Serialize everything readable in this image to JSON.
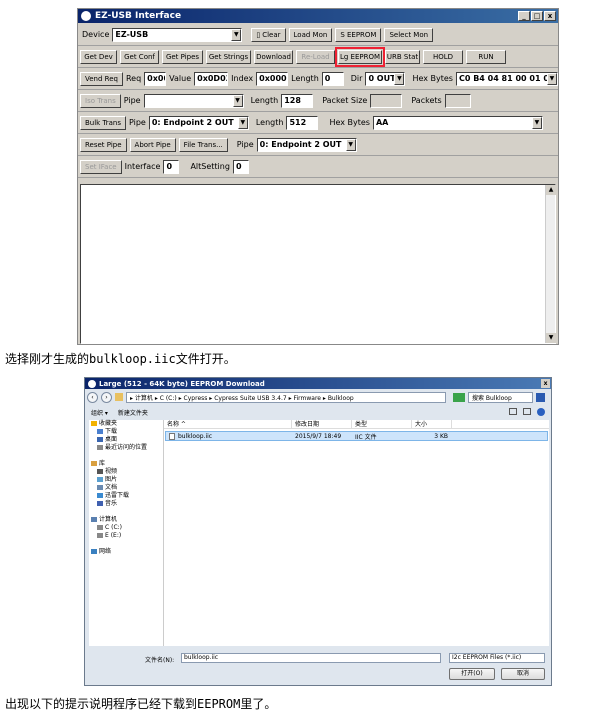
{
  "ezusb": {
    "title": "EZ-USB Interface",
    "win_buttons": [
      "_",
      "□",
      "x"
    ],
    "device_label": "Device",
    "device_value": "EZ-USB",
    "clear_label": "Clear",
    "top_buttons": [
      "Load Mon",
      "S EEPROM",
      "Select Mon"
    ],
    "row2_buttons": [
      "Get Dev",
      "Get Conf",
      "Get Pipes",
      "Get Strings",
      "Download",
      "Re-Load",
      "Lg EEPROM",
      "URB Stat",
      "HOLD",
      "RUN"
    ],
    "vend_req": {
      "button": "Vend Req",
      "req_label": "Req",
      "req_value": "0x00",
      "value_label": "Value",
      "value_value": "0x0D03",
      "index_label": "Index",
      "index_value": "0x0000",
      "length_label": "Length",
      "length_value": "0",
      "dir_label": "Dir",
      "dir_value": "0 OUT",
      "hex_label": "Hex Bytes",
      "hex_value": "C0 B4 04 81 00 01 00"
    },
    "iso_trans": {
      "button": "Iso Trans",
      "pipe_label": "Pipe",
      "pipe_value": "",
      "length_label": "Length",
      "length_value": "128",
      "packet_size_label": "Packet Size",
      "packet_size_value": "",
      "packets_label": "Packets",
      "packets_value": ""
    },
    "bulk_trans": {
      "button": "Bulk Trans",
      "pipe_label": "Pipe",
      "pipe_value": "0: Endpoint 2 OUT",
      "length_label": "Length",
      "length_value": "512",
      "hex_label": "Hex Bytes",
      "hex_value": "AA"
    },
    "reset_row": {
      "buttons": [
        "Reset Pipe",
        "Abort Pipe",
        "File Trans..."
      ],
      "pipe_label": "Pipe",
      "pipe_value": "0: Endpoint 2 OUT"
    },
    "iface_row": {
      "button": "Set IFace",
      "interface_label": "Interface",
      "interface_value": "0",
      "alt_label": "AltSetting",
      "alt_value": "0"
    }
  },
  "caption1": "选择刚才生成的bulkloop.iic文件打开。",
  "dialog": {
    "title": "Large (512 - 64K byte) EEPROM Download",
    "address": "▸ 计算机 ▸ C (C:) ▸ Cypress ▸ Cypress Suite USB 3.4.7 ▸ Firmware ▸ Bulkloop",
    "search_placeholder": "搜索 Bulkloop",
    "organize": "组织 ▾",
    "new_folder": "新建文件夹",
    "nav_items": [
      {
        "label": "收藏夹",
        "color": "#f2b200"
      },
      {
        "label": "下载",
        "color": "#4a7fcf"
      },
      {
        "label": "桌面",
        "color": "#3a66b0"
      },
      {
        "label": "最近访问的位置",
        "color": "#888888"
      },
      {
        "label": "",
        "color": ""
      },
      {
        "label": "库",
        "color": "#d9a040"
      },
      {
        "label": "视频",
        "color": "#555555"
      },
      {
        "label": "图片",
        "color": "#5aa0d0"
      },
      {
        "label": "文档",
        "color": "#6a8ab0"
      },
      {
        "label": "迅雷下载",
        "color": "#3a8ad0"
      },
      {
        "label": "音乐",
        "color": "#4060b0"
      },
      {
        "label": "",
        "color": ""
      },
      {
        "label": "计算机",
        "color": "#5a80b0"
      },
      {
        "label": "C (C:)",
        "color": "#888888"
      },
      {
        "label": "E (E:)",
        "color": "#888888"
      },
      {
        "label": "",
        "color": ""
      },
      {
        "label": "网络",
        "color": "#3a80c0"
      }
    ],
    "columns": [
      "名称 ^",
      "修改日期",
      "类型",
      "大小"
    ],
    "files": [
      {
        "name": "bulkloop.iic",
        "date": "2015/9/7 18:49",
        "type": "IIC 文件",
        "size": "3 KB"
      }
    ],
    "filename_label": "文件名(N):",
    "filename_value": "bulkloop.iic",
    "filter_value": "I2c EEPROM Files (*.iic)",
    "open_label": "打开(O)",
    "cancel_label": "取消"
  },
  "caption2": "出现以下的提示说明程序已经下载到EEPROM里了。"
}
